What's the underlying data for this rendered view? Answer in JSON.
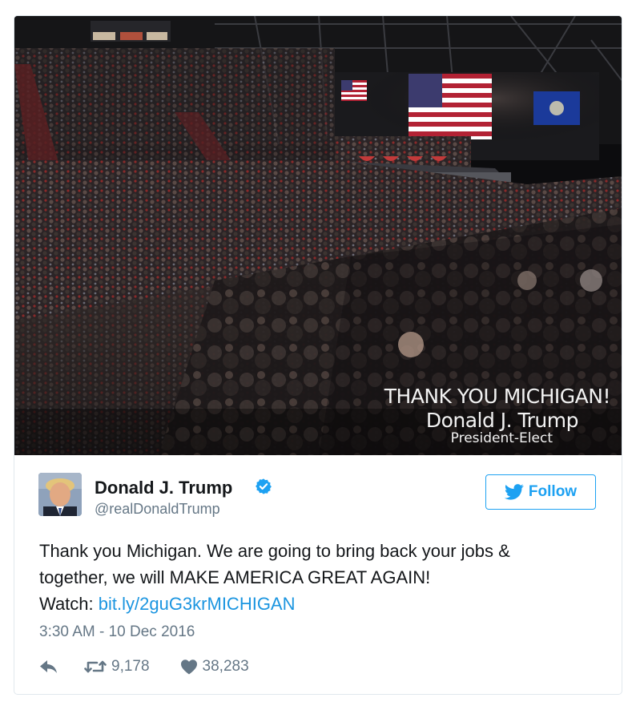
{
  "media": {
    "overlay_line1": "THANK YOU MICHIGAN!",
    "overlay_line2": "Donald J. Trump",
    "overlay_line3": "President-Elect"
  },
  "user": {
    "name": "Donald J. Trump",
    "handle": "@realDonaldTrump",
    "verified_icon": "verified-badge-icon"
  },
  "follow": {
    "label": "Follow",
    "icon": "twitter-bird-icon"
  },
  "tweet": {
    "line1": "Thank you Michigan. We are going to bring back your jobs &",
    "line2": "together, we will MAKE AMERICA GREAT AGAIN!",
    "watch_prefix": "Watch: ",
    "link_text": "bit.ly/2guG3krMICHIGAN"
  },
  "timestamp": "3:30 AM - 10 Dec 2016",
  "actions": {
    "reply_icon": "reply-icon",
    "retweet_icon": "retweet-icon",
    "retweets": "9,178",
    "like_icon": "heart-icon",
    "likes": "38,283"
  },
  "colors": {
    "accent": "#1da1f2",
    "link": "#1b95e0",
    "secondary_text": "#657786",
    "border": "#e1e8ed"
  }
}
